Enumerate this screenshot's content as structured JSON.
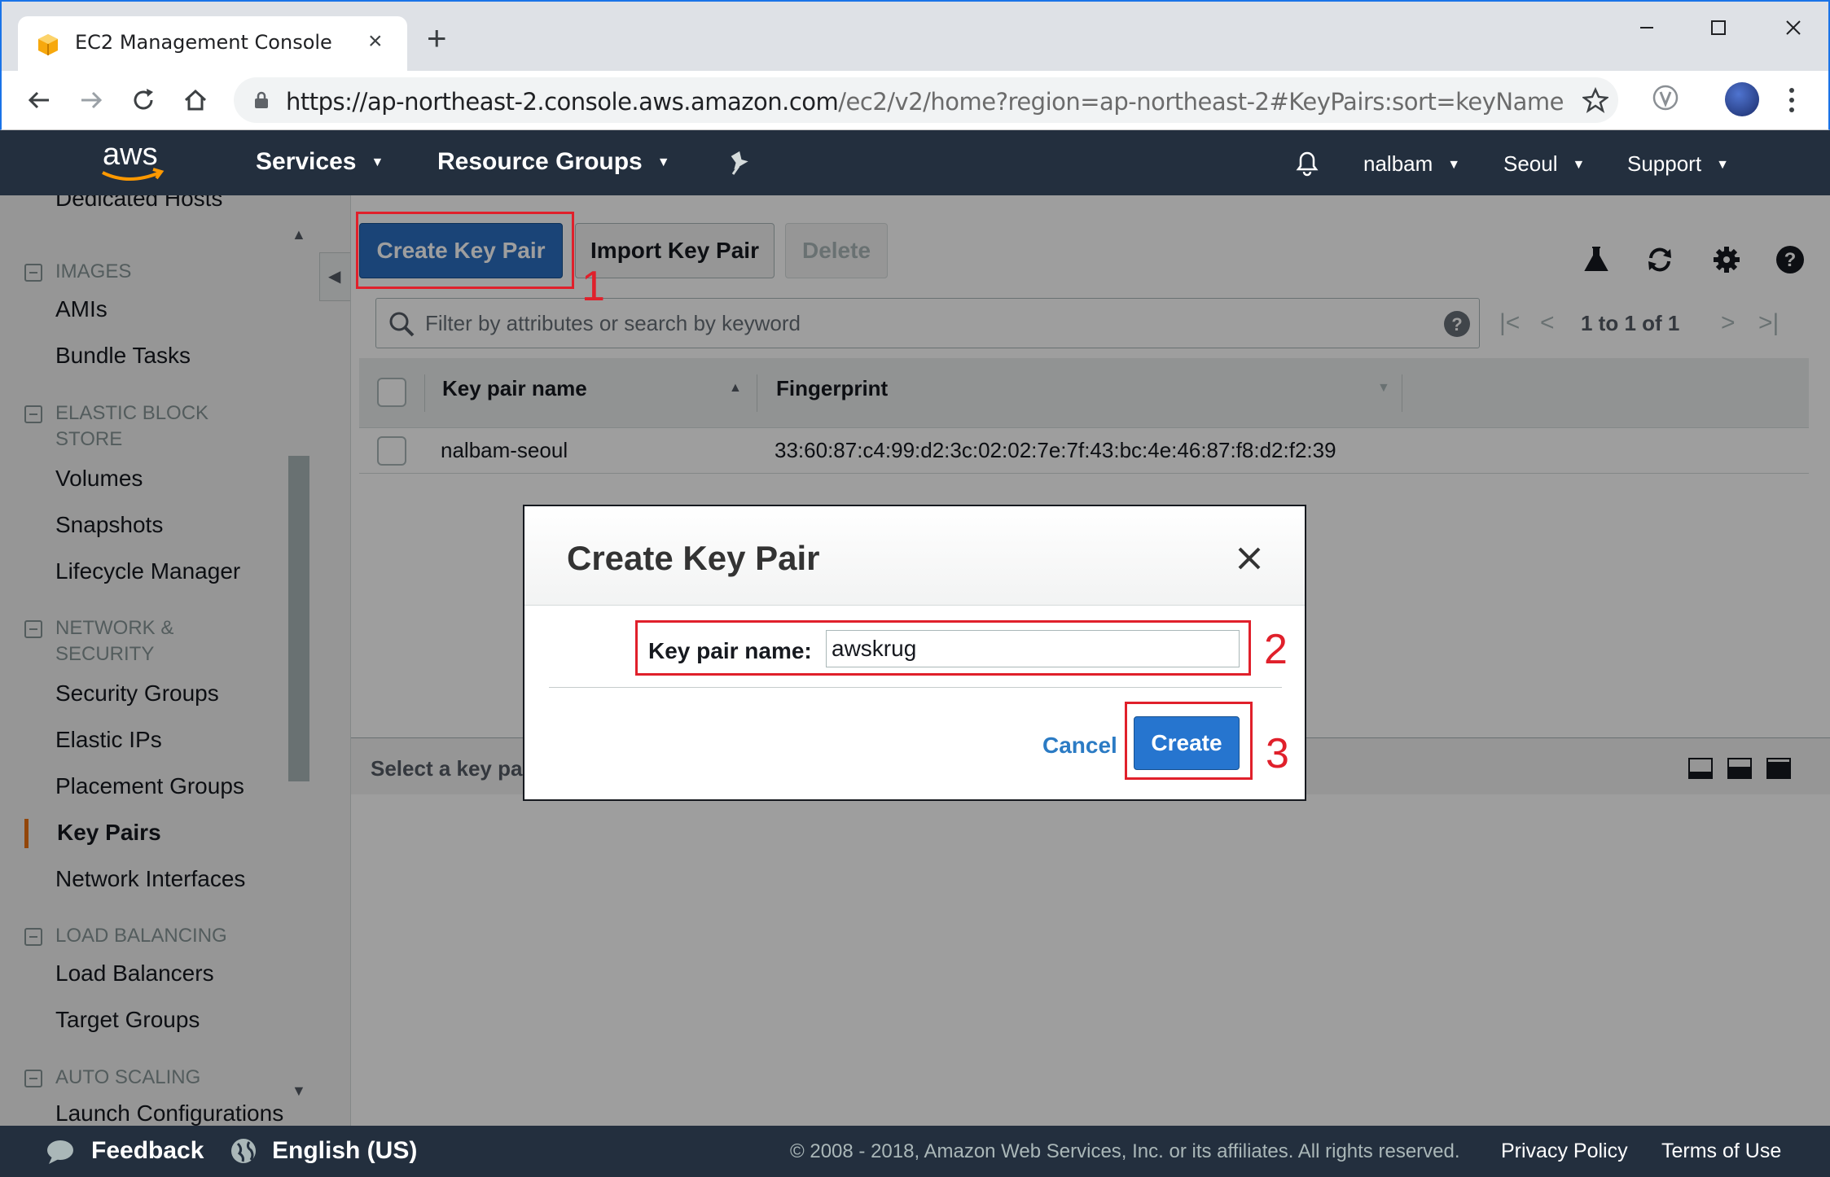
{
  "browser": {
    "tab_title": "EC2 Management Console",
    "tab_close": "×",
    "new_tab": "+",
    "url_main": "https://ap-northeast-2.console.aws.amazon.com",
    "url_rest": "/ec2/v2/home?region=ap-northeast-2#KeyPairs:sort=keyName",
    "icons": [
      "favicon-icon",
      "back-icon",
      "forward-icon",
      "reload-icon",
      "home-icon",
      "lock-icon",
      "star-icon",
      "extension-icon",
      "menu-icon",
      "minimize-icon",
      "maximize-icon",
      "close-icon"
    ]
  },
  "aws_header": {
    "logo_text": "aws",
    "services": "Services",
    "resource_groups": "Resource Groups",
    "user": "nalbam",
    "region": "Seoul",
    "support": "Support",
    "caret": "▼",
    "icons": [
      "pin-icon",
      "bell-icon"
    ],
    "background": "#232f3e"
  },
  "sidebar": {
    "cut_off_item": "Dedicated Hosts",
    "sections": [
      {
        "label": "IMAGES",
        "items": [
          "AMIs",
          "Bundle Tasks"
        ]
      },
      {
        "label": "ELASTIC BLOCK STORE",
        "items": [
          "Volumes",
          "Snapshots",
          "Lifecycle Manager"
        ]
      },
      {
        "label": "NETWORK & SECURITY",
        "items": [
          "Security Groups",
          "Elastic IPs",
          "Placement Groups",
          "Key Pairs",
          "Network Interfaces"
        ]
      },
      {
        "label": "LOAD BALANCING",
        "items": [
          "Load Balancers",
          "Target Groups"
        ]
      },
      {
        "label": "AUTO SCALING",
        "items": [
          "Launch Configurations"
        ]
      }
    ],
    "active_item": "Key Pairs",
    "active_color": "#ec7211",
    "scroll_up": "▲",
    "scroll_down": "▼"
  },
  "actions": {
    "create_key_pair": "Create Key Pair",
    "import_key_pair": "Import Key Pair",
    "delete": "Delete",
    "collapse": "◀",
    "icons": [
      "lab-icon",
      "refresh-icon",
      "settings-icon",
      "help-icon"
    ]
  },
  "filter": {
    "placeholder": "Filter by attributes or search by keyword"
  },
  "pagination": {
    "text": "1 to 1 of 1",
    "first": "|<",
    "prev": "<",
    "next": ">",
    "last": ">|"
  },
  "table": {
    "columns": [
      "Key pair name",
      "Fingerprint"
    ],
    "sort_asc": "▲",
    "sort_desc": "▼",
    "rows": [
      {
        "name": "nalbam-seoul",
        "fingerprint": "33:60:87:c4:99:d2:3c:02:02:7e:7f:43:bc:4e:46:87:f8:d2:f2:39"
      }
    ]
  },
  "details": {
    "text": "Select a key pair above"
  },
  "modal": {
    "title": "Create Key Pair",
    "field_label": "Key pair name:",
    "field_value": "awskrug",
    "cancel": "Cancel",
    "create": "Create",
    "primary_color": "#2675cf"
  },
  "annotations": {
    "step_1": "1",
    "step_2": "2",
    "step_3": "3",
    "color": "#e0202b"
  },
  "footer": {
    "feedback": "Feedback",
    "language": "English (US)",
    "copyright": "© 2008 - 2018, Amazon Web Services, Inc. or its affiliates. All rights reserved.",
    "privacy": "Privacy Policy",
    "terms": "Terms of Use"
  }
}
